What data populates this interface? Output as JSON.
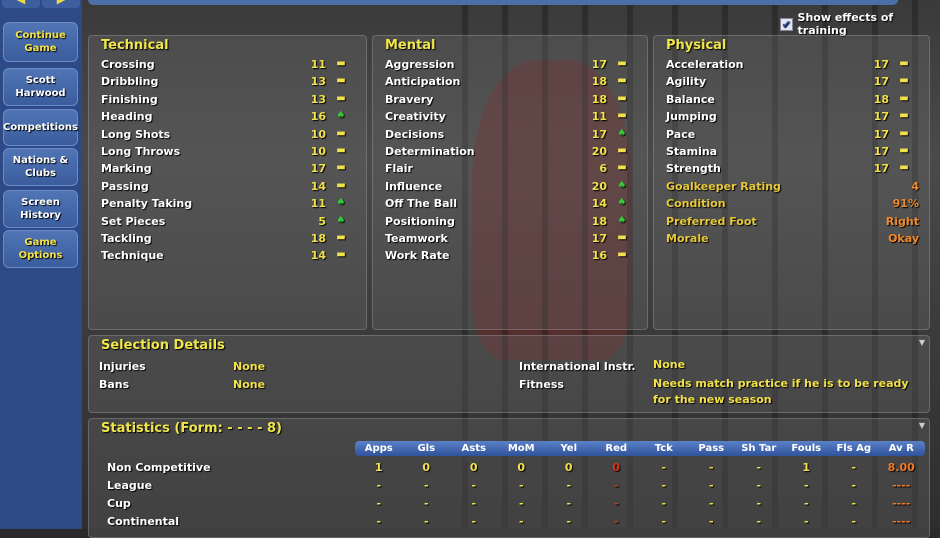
{
  "sidebar": {
    "items": [
      {
        "label": "Continue Game",
        "highlight": true
      },
      {
        "label": "Scott Harwood",
        "highlight": false
      },
      {
        "label": "Competitions",
        "highlight": false
      },
      {
        "label": "Nations & Clubs",
        "highlight": false
      },
      {
        "label": "Screen History",
        "highlight": false
      },
      {
        "label": "Game Options",
        "highlight": true
      }
    ],
    "back_icon": "arrow-left-icon",
    "forward_icon": "arrow-right-icon"
  },
  "training": {
    "label": "Show effects of training",
    "checked": true
  },
  "technical": {
    "title": "Technical",
    "rows": [
      {
        "label": "Crossing",
        "value": "11",
        "trend": "-"
      },
      {
        "label": "Dribbling",
        "value": "13",
        "trend": "-"
      },
      {
        "label": "Finishing",
        "value": "13",
        "trend": "-"
      },
      {
        "label": "Heading",
        "value": "16",
        "trend": "up"
      },
      {
        "label": "Long Shots",
        "value": "10",
        "trend": "-"
      },
      {
        "label": "Long Throws",
        "value": "10",
        "trend": "-"
      },
      {
        "label": "Marking",
        "value": "17",
        "trend": "-"
      },
      {
        "label": "Passing",
        "value": "14",
        "trend": "-"
      },
      {
        "label": "Penalty Taking",
        "value": "11",
        "trend": "up"
      },
      {
        "label": "Set Pieces",
        "value": "5",
        "trend": "up"
      },
      {
        "label": "Tackling",
        "value": "18",
        "trend": "-"
      },
      {
        "label": "Technique",
        "value": "14",
        "trend": "-"
      }
    ]
  },
  "mental": {
    "title": "Mental",
    "rows": [
      {
        "label": "Aggression",
        "value": "17",
        "trend": "-"
      },
      {
        "label": "Anticipation",
        "value": "18",
        "trend": "-"
      },
      {
        "label": "Bravery",
        "value": "18",
        "trend": "-"
      },
      {
        "label": "Creativity",
        "value": "11",
        "trend": "-"
      },
      {
        "label": "Decisions",
        "value": "17",
        "trend": "up"
      },
      {
        "label": "Determination",
        "value": "20",
        "trend": "-"
      },
      {
        "label": "Flair",
        "value": "6",
        "trend": "-"
      },
      {
        "label": "Influence",
        "value": "20",
        "trend": "up"
      },
      {
        "label": "Off The Ball",
        "value": "14",
        "trend": "up"
      },
      {
        "label": "Positioning",
        "value": "18",
        "trend": "up"
      },
      {
        "label": "Teamwork",
        "value": "17",
        "trend": "-"
      },
      {
        "label": "Work Rate",
        "value": "16",
        "trend": "-"
      }
    ]
  },
  "physical": {
    "title": "Physical",
    "rows": [
      {
        "label": "Acceleration",
        "value": "17",
        "trend": "-"
      },
      {
        "label": "Agility",
        "value": "17",
        "trend": "-"
      },
      {
        "label": "Balance",
        "value": "18",
        "trend": "-"
      },
      {
        "label": "Jumping",
        "value": "17",
        "trend": "-"
      },
      {
        "label": "Pace",
        "value": "17",
        "trend": "-"
      },
      {
        "label": "Stamina",
        "value": "17",
        "trend": "-"
      },
      {
        "label": "Strength",
        "value": "17",
        "trend": "-"
      }
    ],
    "extra": [
      {
        "label": "Goalkeeper Rating",
        "value": "4"
      },
      {
        "label": "Condition",
        "value": "91%"
      },
      {
        "label": "Preferred Foot",
        "value": "Right"
      },
      {
        "label": "Morale",
        "value": "Okay"
      }
    ]
  },
  "selection": {
    "title": "Selection Details",
    "injuries_label": "Injuries",
    "injuries": "None",
    "bans_label": "Bans",
    "bans": "None",
    "intl_label": "International Instr.",
    "intl": "None",
    "fitness_label": "Fitness",
    "fitness": "Needs match practice if he is to be ready for the new season"
  },
  "statistics": {
    "title": "Statistics (Form: - - - - 8)",
    "columns": [
      "Apps",
      "Gls",
      "Asts",
      "MoM",
      "Yel",
      "Red",
      "Tck",
      "Pass",
      "Sh Tar",
      "Fouls",
      "Fls Ag",
      "Av R"
    ],
    "rows": [
      {
        "label": "Non Competitive",
        "values": [
          "1",
          "0",
          "0",
          "0",
          "0",
          "0",
          "-",
          "-",
          "-",
          "1",
          "-",
          "8.00"
        ]
      },
      {
        "label": "League",
        "values": [
          "-",
          "-",
          "-",
          "-",
          "-",
          "-",
          "-",
          "-",
          "-",
          "-",
          "-",
          "----"
        ]
      },
      {
        "label": "Cup",
        "values": [
          "-",
          "-",
          "-",
          "-",
          "-",
          "-",
          "-",
          "-",
          "-",
          "-",
          "-",
          "----"
        ]
      },
      {
        "label": "Continental",
        "values": [
          "-",
          "-",
          "-",
          "-",
          "-",
          "-",
          "-",
          "-",
          "-",
          "-",
          "-",
          "----"
        ]
      }
    ]
  },
  "colors": {
    "accent": "#f2e24a",
    "up": "#36c83a",
    "sidebar": "#2d4a86"
  }
}
